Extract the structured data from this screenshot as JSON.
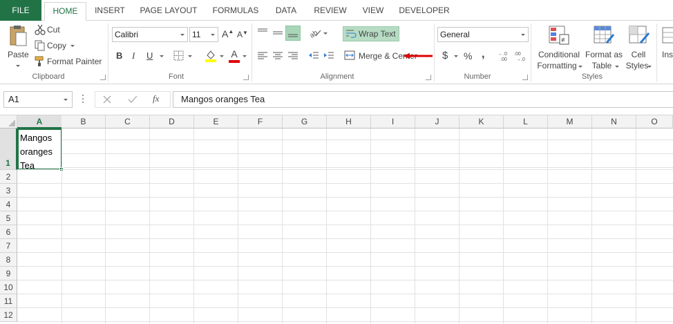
{
  "ribbon_tabs": [
    {
      "label": "FILE"
    },
    {
      "label": "HOME"
    },
    {
      "label": "INSERT"
    },
    {
      "label": "PAGE LAYOUT"
    },
    {
      "label": "FORMULAS"
    },
    {
      "label": "DATA"
    },
    {
      "label": "REVIEW"
    },
    {
      "label": "VIEW"
    },
    {
      "label": "DEVELOPER"
    }
  ],
  "clipboard": {
    "paste": "Paste",
    "cut": "Cut",
    "copy": "Copy",
    "format_painter": "Format Painter",
    "label": "Clipboard"
  },
  "font": {
    "name": "Calibri",
    "size": "11",
    "bold": "B",
    "italic": "I",
    "underline": "U",
    "grow": "A",
    "shrink": "A",
    "color_letter": "A",
    "label": "Font"
  },
  "alignment": {
    "wrap_text": "Wrap Text",
    "merge_center": "Merge & Center",
    "label": "Alignment"
  },
  "number": {
    "format": "General",
    "currency": "$",
    "percent": "%",
    "comma": ",",
    "label": "Number"
  },
  "styles": {
    "conditional_1": "Conditional",
    "conditional_2": "Formatting",
    "format_table_1": "Format as",
    "format_table_2": "Table",
    "cell_styles_1": "Cell",
    "cell_styles_2": "Styles",
    "label": "Styles"
  },
  "insert_partial": "Ins",
  "formula_bar": {
    "name_box": "A1",
    "fx": "fx",
    "formula": "Mangos oranges  Tea"
  },
  "columns": [
    "A",
    "B",
    "C",
    "D",
    "E",
    "F",
    "G",
    "H",
    "I",
    "J",
    "K",
    "L",
    "M",
    "N",
    "O"
  ],
  "rows": [
    "1",
    "2",
    "3",
    "4",
    "5",
    "6",
    "7",
    "8",
    "9",
    "10",
    "11",
    "12"
  ],
  "cell_a1": {
    "line1": "Mangos",
    "line2": "oranges",
    "line3": "Tea"
  },
  "colors": {
    "accent": "#217346",
    "wrap_highlight": "#b6dcc4",
    "arrow": "#e00000"
  }
}
